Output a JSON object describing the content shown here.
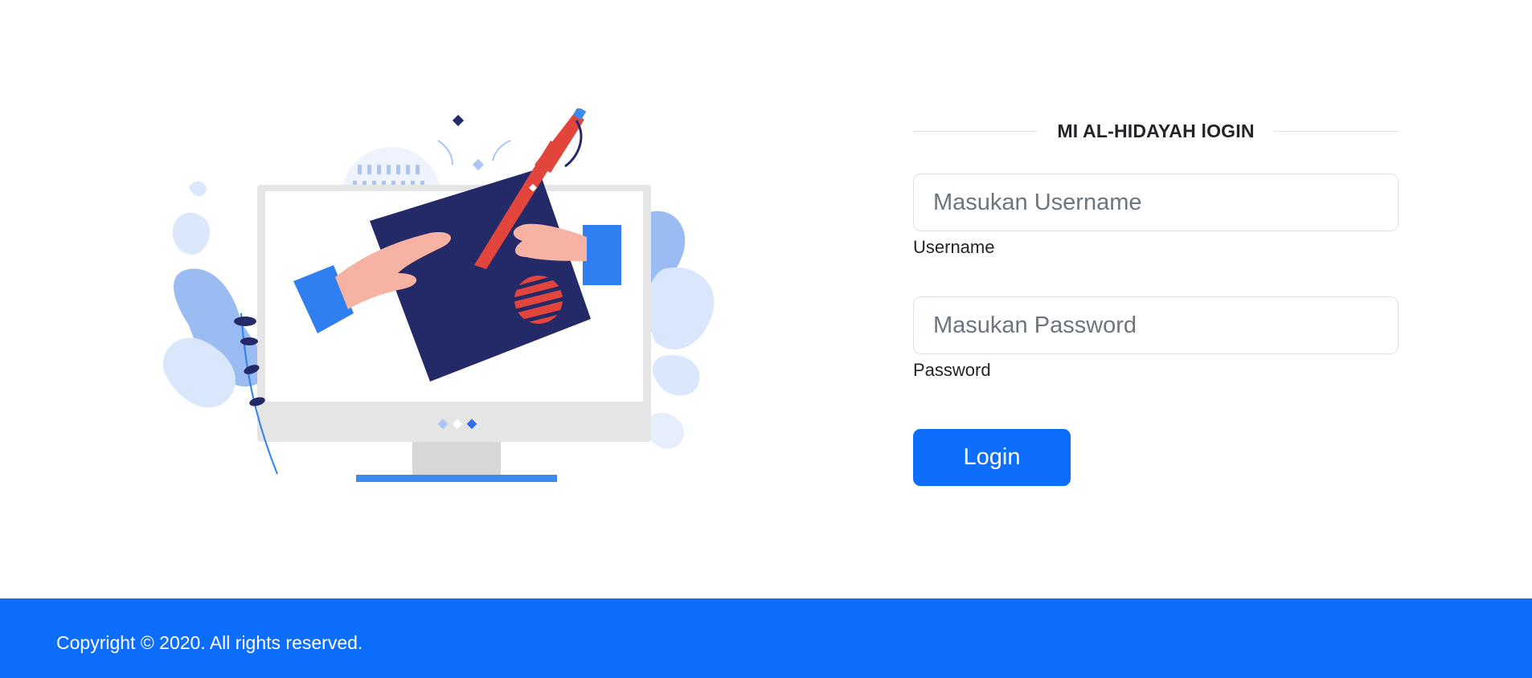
{
  "login": {
    "title": "MI AL-HIDAYAH lOGIN",
    "username": {
      "placeholder": "Masukan Username",
      "value": "",
      "label": "Username"
    },
    "password": {
      "placeholder": "Masukan Password",
      "value": "",
      "label": "Password"
    },
    "submit_label": "Login"
  },
  "footer": {
    "copyright": "Copyright © 2020. All rights reserved."
  },
  "colors": {
    "primary": "#0d6efd",
    "navy": "#232a67",
    "accent_red": "#e2453c",
    "light_blue": "#a9c6f7",
    "text": "#212529",
    "border": "#dee2e6"
  },
  "illustration": {
    "icon": "computer-drawing-illustration"
  }
}
